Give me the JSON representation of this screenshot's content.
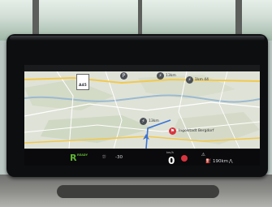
{
  "map": {
    "road_shield_top": "A45",
    "poi_parking": "P",
    "poi_1_label": "13km",
    "poi_2_label": "1km 44",
    "poi_3_label": "13km",
    "destination_label": "Ingolstadt Bergdorf"
  },
  "status_bar": {
    "drive_mode": "R",
    "ready_label": "READY",
    "outside_temp": "-30",
    "speed": "0",
    "speed_unit": "km/h",
    "range": "190km"
  },
  "colors": {
    "ready_green": "#5fb431",
    "map_bg": "#dfe2d6",
    "route_blue": "#3a73d6",
    "warning_red": "#d8343e"
  }
}
